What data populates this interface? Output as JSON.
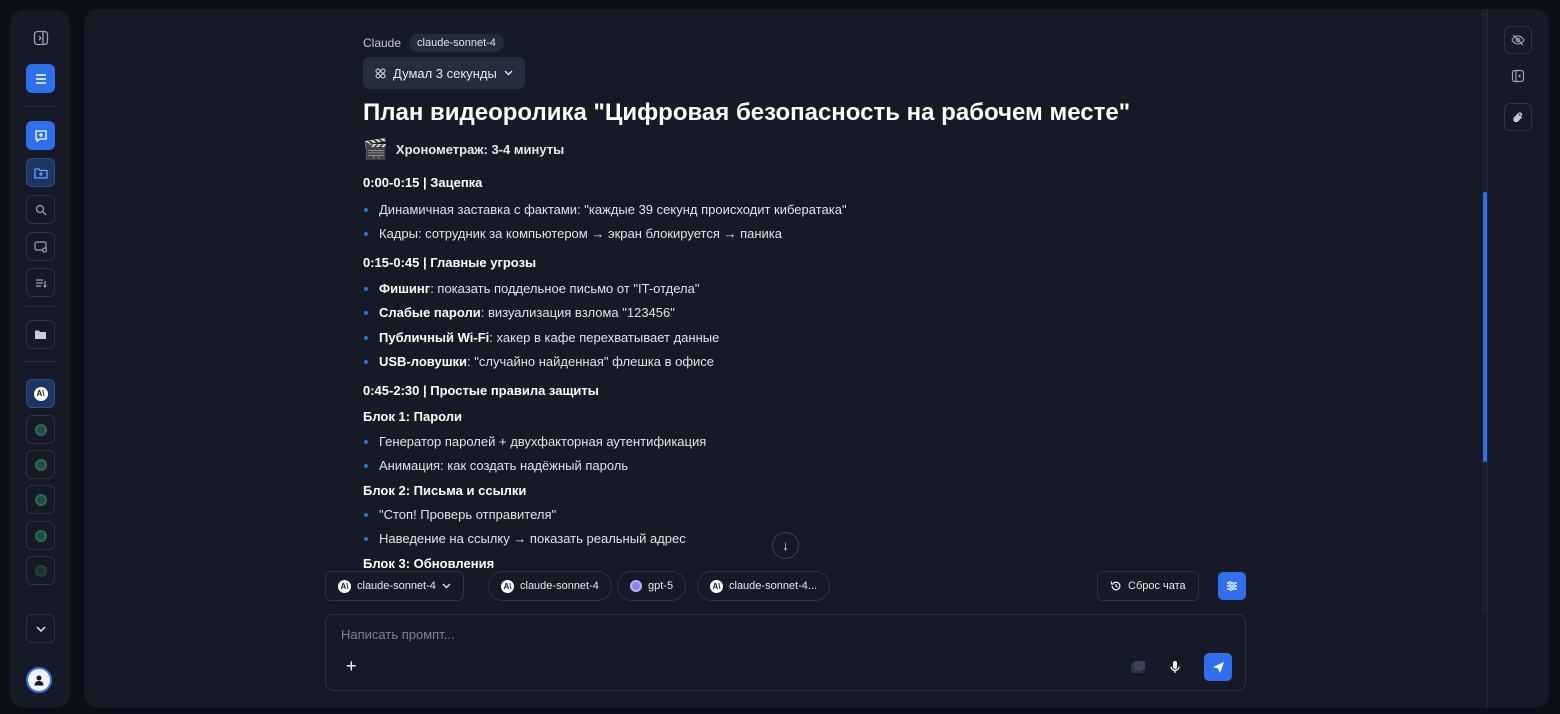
{
  "rail": {
    "icons": [
      "panel-toggle-icon",
      "menu-icon",
      "new-chat-icon",
      "folder-add-icon",
      "search-icon",
      "image-chat-icon",
      "list-icon",
      "folder-icon",
      "anthropic-icon"
    ],
    "avatar_icon": "user-icon"
  },
  "message": {
    "sender": "Claude",
    "model": "claude-sonnet-4",
    "think_label": "Думал 3 секунды",
    "title": "План видеоролика \"Цифровая безопасность на рабочем месте\"",
    "timing_emoji": "🎬",
    "timing": "Хронометраж: 3-4 минуты",
    "sections": {
      "hook": {
        "heading": "0:00-0:15 | Зацепка",
        "items": [
          "Динамичная заставка с фактами: \"каждые 39 секунд происходит кибератака\"",
          "Кадры: сотрудник за компьютером → экран блокируется → паника"
        ]
      },
      "threats": {
        "heading": "0:15-0:45 | Главные угрозы",
        "items": [
          {
            "bold": "Фишинг",
            "text": ": показать поддельное письмо от \"IT-отдела\""
          },
          {
            "bold": "Слабые пароли",
            "text": ": визуализация взлома \"123456\""
          },
          {
            "bold": "Публичный Wi-Fi",
            "text": ": хакер в кафе перехватывает данные"
          },
          {
            "bold": "USB-ловушки",
            "text": ": \"случайно найденная\" флешка в офисе"
          }
        ]
      },
      "rules": {
        "heading": "0:45-2:30 | Простые правила защиты",
        "blocks": [
          {
            "heading": "Блок 1: Пароли",
            "items": [
              "Генератор паролей + двухфакторная аутентификация",
              "Анимация: как создать надёжный пароль"
            ]
          },
          {
            "heading": "Блок 2: Письма и ссылки",
            "items": [
              "\"Стоп! Проверь отправителя\"",
              "Наведение на ссылку → показать реальный адрес"
            ]
          },
          {
            "heading": "Блок 3: Обновления",
            "items": []
          }
        ]
      }
    }
  },
  "controls": {
    "scroll_down": "↓",
    "model_select": "claude-sonnet-4",
    "model_chips": [
      "claude-sonnet-4",
      "gpt-5",
      "claude-sonnet-4..."
    ],
    "reset_label": "Сброс чата",
    "prompt_placeholder": "Написать промпт...",
    "plus": "+"
  },
  "colors": {
    "accent": "#2f6fed",
    "panel": "#151a26",
    "background": "#0c0f17"
  }
}
